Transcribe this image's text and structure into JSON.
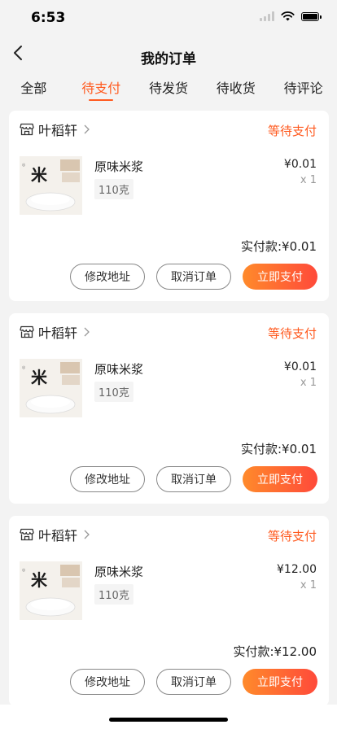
{
  "status_bar": {
    "time": "6:53"
  },
  "nav": {
    "title": "我的订单"
  },
  "tabs": [
    {
      "label": "全部",
      "active": false
    },
    {
      "label": "待支付",
      "active": true
    },
    {
      "label": "待发货",
      "active": false
    },
    {
      "label": "待收货",
      "active": false
    },
    {
      "label": "待评论",
      "active": false
    }
  ],
  "colors": {
    "accent": "#ff5a1f",
    "button_gradient_start": "#ff8a2b",
    "button_gradient_end": "#ff4a3a"
  },
  "orders": [
    {
      "shop_name": "叶稻轩",
      "status": "等待支付",
      "product_name": "原味米浆",
      "spec": "110克",
      "price": "¥0.01",
      "qty": "x 1",
      "paid_label": "实付款:",
      "paid_amount": "¥0.01",
      "buttons": {
        "modify": "修改地址",
        "cancel": "取消订单",
        "pay": "立即支付"
      }
    },
    {
      "shop_name": "叶稻轩",
      "status": "等待支付",
      "product_name": "原味米浆",
      "spec": "110克",
      "price": "¥0.01",
      "qty": "x 1",
      "paid_label": "实付款:",
      "paid_amount": "¥0.01",
      "buttons": {
        "modify": "修改地址",
        "cancel": "取消订单",
        "pay": "立即支付"
      }
    },
    {
      "shop_name": "叶稻轩",
      "status": "等待支付",
      "product_name": "原味米浆",
      "spec": "110克",
      "price": "¥12.00",
      "qty": "x 1",
      "paid_label": "实付款:",
      "paid_amount": "¥12.00",
      "buttons": {
        "modify": "修改地址",
        "cancel": "取消订单",
        "pay": "立即支付"
      }
    }
  ],
  "icons": {
    "back": "chevron-left-icon",
    "shop": "shop-icon",
    "chevron": "chevron-right-icon"
  }
}
